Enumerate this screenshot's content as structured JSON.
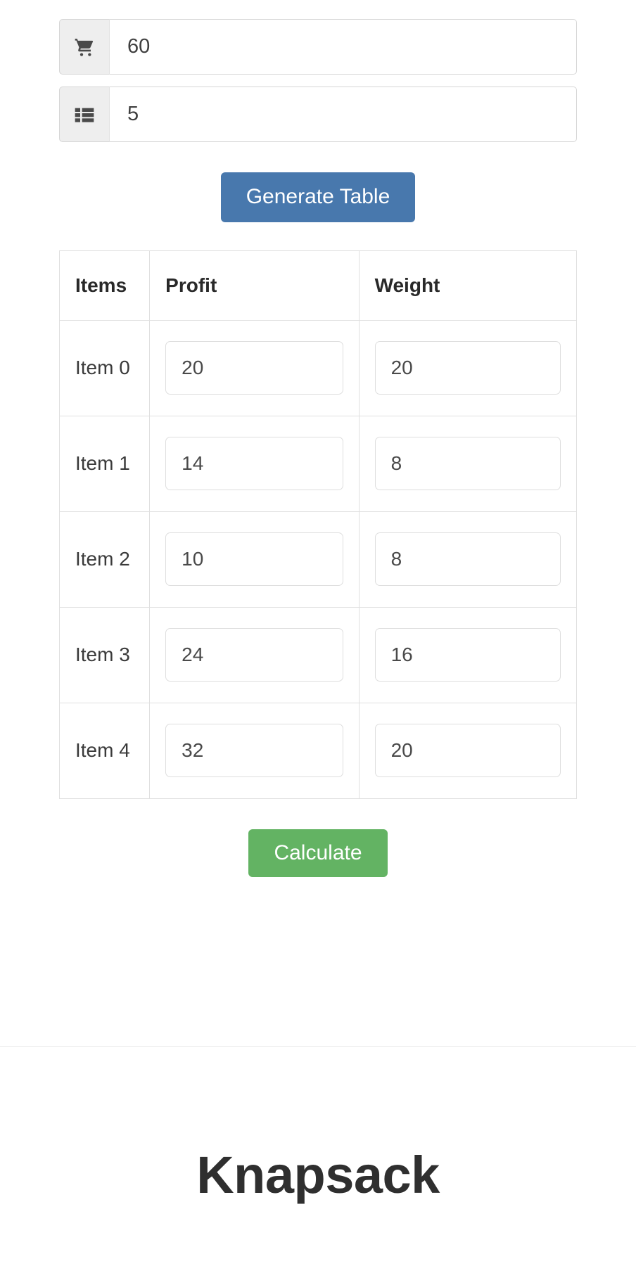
{
  "inputs": [
    {
      "icon": "shopping-cart-icon",
      "name": "capacity",
      "value": "60",
      "placeholder": "Capacity"
    },
    {
      "icon": "list-icon",
      "name": "item-count",
      "value": "5",
      "placeholder": "Number of items"
    }
  ],
  "buttons": {
    "generate_table": "Generate Table",
    "calculate": "Calculate"
  },
  "table": {
    "headers": [
      "Items",
      "Profit",
      "Weight"
    ],
    "rows": [
      {
        "item": "Item 0",
        "profit": "20",
        "weight": "20"
      },
      {
        "item": "Item 1",
        "profit": "14",
        "weight": "8"
      },
      {
        "item": "Item 2",
        "profit": "10",
        "weight": "8"
      },
      {
        "item": "Item 3",
        "profit": "24",
        "weight": "16"
      },
      {
        "item": "Item 4",
        "profit": "32",
        "weight": "20"
      }
    ]
  },
  "footer": {
    "title": "Knapsack"
  },
  "colors": {
    "primary": "#4878ad",
    "success": "#63b363",
    "addon_bg": "#eeeeee",
    "border": "#e0e0e0"
  }
}
